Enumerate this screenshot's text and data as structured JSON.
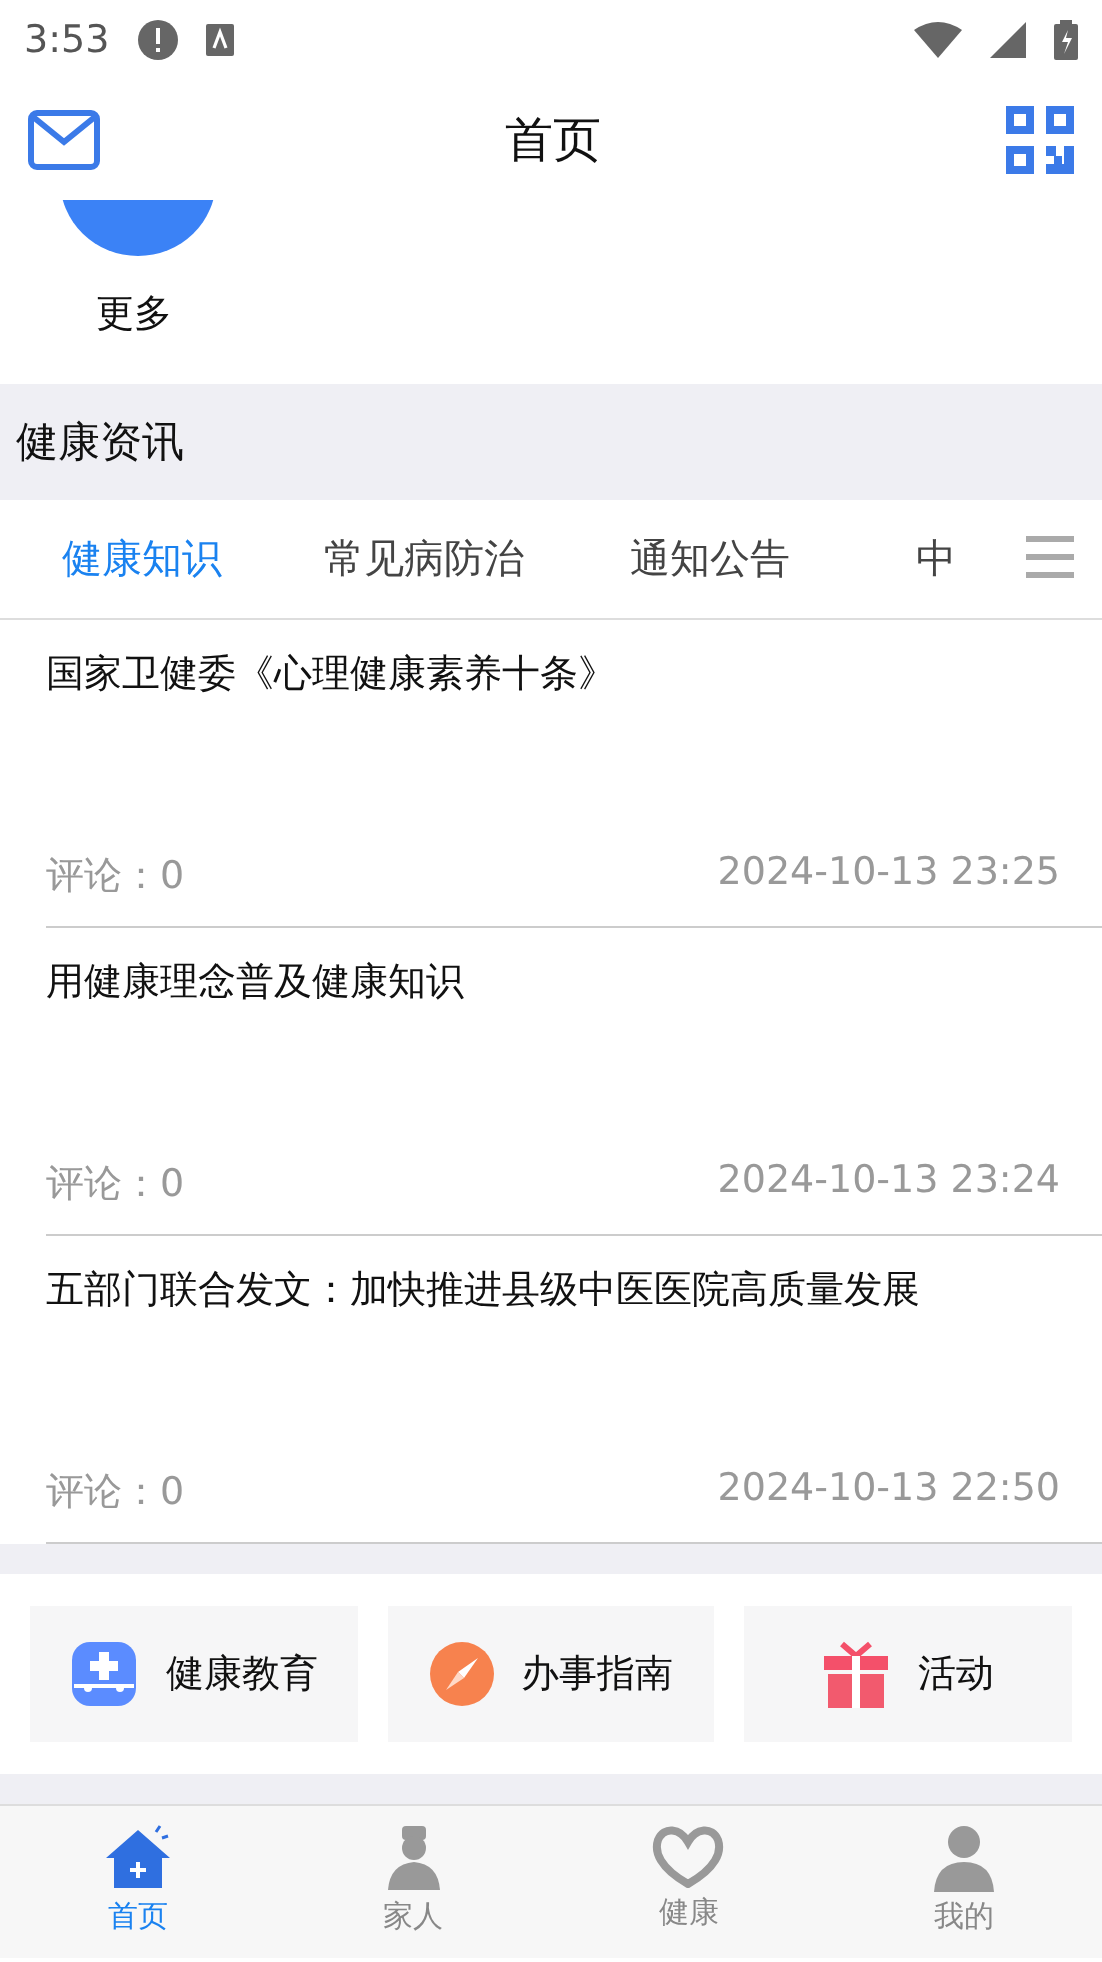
{
  "status_bar": {
    "time": "3:53"
  },
  "header": {
    "title": "首页"
  },
  "more": {
    "label": "更多"
  },
  "section": {
    "title": "健康资讯"
  },
  "tabs": [
    {
      "label": "健康知识",
      "selected": true
    },
    {
      "label": "常见病防治",
      "selected": false
    },
    {
      "label": "通知公告",
      "selected": false
    },
    {
      "label": "中",
      "selected": false
    }
  ],
  "articles": [
    {
      "title": "国家卫健委《心理健康素养十条》",
      "comments": "评论：0",
      "time": "2024-10-13 23:25"
    },
    {
      "title": "用健康理念普及健康知识",
      "comments": "评论：0",
      "time": "2024-10-13 23:24"
    },
    {
      "title": "五部门联合发文：加快推进县级中医医院高质量发展",
      "comments": "评论：0",
      "time": "2024-10-13 22:50"
    }
  ],
  "shortcuts": [
    {
      "kind": "education",
      "label": "健康教育"
    },
    {
      "kind": "guide",
      "label": "办事指南"
    },
    {
      "kind": "activity",
      "label": "活动"
    }
  ],
  "bottom_nav": [
    {
      "kind": "home",
      "label": "首页",
      "selected": true
    },
    {
      "kind": "family",
      "label": "家人",
      "selected": false
    },
    {
      "kind": "health",
      "label": "健康",
      "selected": false
    },
    {
      "kind": "mine",
      "label": "我的",
      "selected": false
    }
  ]
}
